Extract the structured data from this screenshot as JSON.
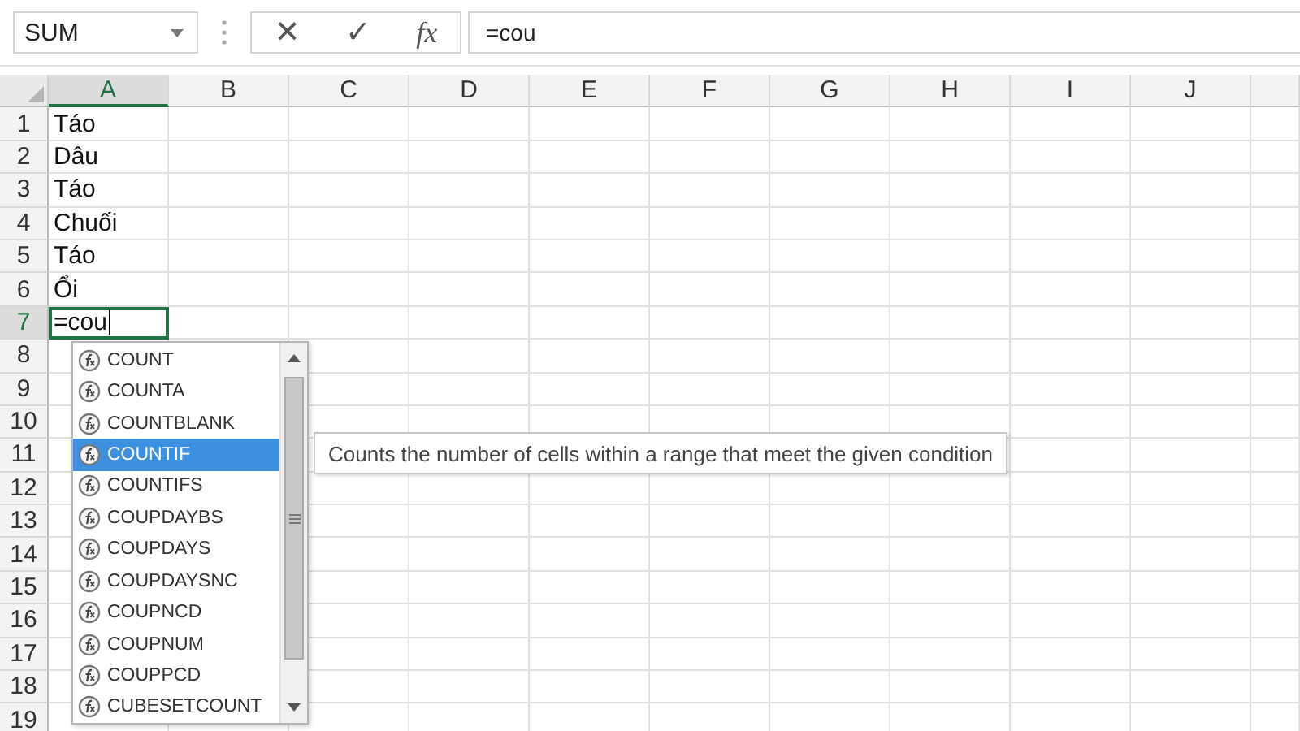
{
  "name_box": {
    "value": "SUM"
  },
  "formula_bar": {
    "cancel": "✕",
    "enter": "✓",
    "function": "fx",
    "value": "=cou"
  },
  "columns": [
    {
      "label": "A",
      "selected": true
    },
    {
      "label": "B",
      "selected": false
    },
    {
      "label": "C",
      "selected": false
    },
    {
      "label": "D",
      "selected": false
    },
    {
      "label": "E",
      "selected": false
    },
    {
      "label": "F",
      "selected": false
    },
    {
      "label": "G",
      "selected": false
    },
    {
      "label": "H",
      "selected": false
    },
    {
      "label": "I",
      "selected": false
    },
    {
      "label": "J",
      "selected": false
    }
  ],
  "rows": [
    {
      "number": "1",
      "selected": false,
      "editing": false,
      "a": "Táo"
    },
    {
      "number": "2",
      "selected": false,
      "editing": false,
      "a": "Dâu"
    },
    {
      "number": "3",
      "selected": false,
      "editing": false,
      "a": "Táo"
    },
    {
      "number": "4",
      "selected": false,
      "editing": false,
      "a": "Chuối"
    },
    {
      "number": "5",
      "selected": false,
      "editing": false,
      "a": "Táo"
    },
    {
      "number": "6",
      "selected": false,
      "editing": false,
      "a": "Ổi"
    },
    {
      "number": "7",
      "selected": true,
      "editing": true,
      "a": "=cou"
    },
    {
      "number": "8",
      "selected": false,
      "editing": false
    },
    {
      "number": "9",
      "selected": false,
      "editing": false
    },
    {
      "number": "10",
      "selected": false,
      "editing": false
    },
    {
      "number": "11",
      "selected": false,
      "editing": false
    },
    {
      "number": "12",
      "selected": false,
      "editing": false
    },
    {
      "number": "13",
      "selected": false,
      "editing": false
    },
    {
      "number": "14",
      "selected": false,
      "editing": false
    },
    {
      "number": "15",
      "selected": false,
      "editing": false
    },
    {
      "number": "16",
      "selected": false,
      "editing": false
    },
    {
      "number": "17",
      "selected": false,
      "editing": false
    },
    {
      "number": "18",
      "selected": false,
      "editing": false
    },
    {
      "number": "19",
      "selected": false,
      "editing": false
    }
  ],
  "autocomplete": {
    "items": [
      {
        "label": "COUNT",
        "selected": false
      },
      {
        "label": "COUNTA",
        "selected": false
      },
      {
        "label": "COUNTBLANK",
        "selected": false
      },
      {
        "label": "COUNTIF",
        "selected": true
      },
      {
        "label": "COUNTIFS",
        "selected": false
      },
      {
        "label": "COUPDAYBS",
        "selected": false
      },
      {
        "label": "COUPDAYS",
        "selected": false
      },
      {
        "label": "COUPDAYSNC",
        "selected": false
      },
      {
        "label": "COUPNCD",
        "selected": false
      },
      {
        "label": "COUPNUM",
        "selected": false
      },
      {
        "label": "COUPPCD",
        "selected": false
      },
      {
        "label": "CUBESETCOUNT",
        "selected": false
      }
    ],
    "tooltip": "Counts the number of cells within a range that meet the given condition"
  }
}
